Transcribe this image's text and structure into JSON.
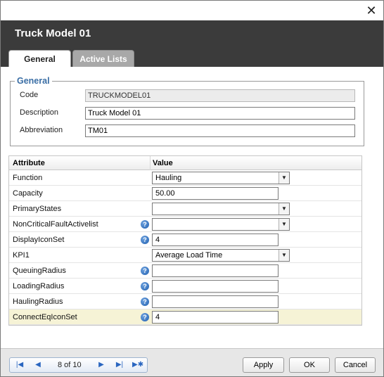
{
  "window": {
    "close_glyph": "✕"
  },
  "header": {
    "title": "Truck Model 01"
  },
  "tabs": [
    {
      "label": "General"
    },
    {
      "label": "Active Lists"
    }
  ],
  "general_group": {
    "legend": "General",
    "fields": [
      {
        "label": "Code",
        "value": "TRUCKMODEL01"
      },
      {
        "label": "Description",
        "value": "Truck Model 01"
      },
      {
        "label": "Abbreviation",
        "value": "TM01"
      }
    ]
  },
  "grid": {
    "headers": {
      "attribute": "Attribute",
      "value": "Value"
    },
    "rows": [
      {
        "attribute": "Function",
        "value": "Hauling"
      },
      {
        "attribute": "Capacity",
        "value": "50.00"
      },
      {
        "attribute": "PrimaryStates",
        "value": ""
      },
      {
        "attribute": "NonCriticalFaultActivelist",
        "value": ""
      },
      {
        "attribute": "DisplayIconSet",
        "value": "4"
      },
      {
        "attribute": "KPI1",
        "value": "Average Load Time"
      },
      {
        "attribute": "QueuingRadius",
        "value": ""
      },
      {
        "attribute": "LoadingRadius",
        "value": ""
      },
      {
        "attribute": "HaulingRadius",
        "value": ""
      },
      {
        "attribute": "ConnectEqIconSet",
        "value": "4"
      }
    ],
    "help_glyph": "?"
  },
  "pager": {
    "count": "8 of 10"
  },
  "buttons": {
    "apply": "Apply",
    "ok": "OK",
    "cancel": "Cancel"
  },
  "colors": {
    "header_bg": "#3b3b3b",
    "legend": "#3a6ea5",
    "selected_row": "#f6f3d6",
    "help_icon": "#1f5fb0"
  }
}
